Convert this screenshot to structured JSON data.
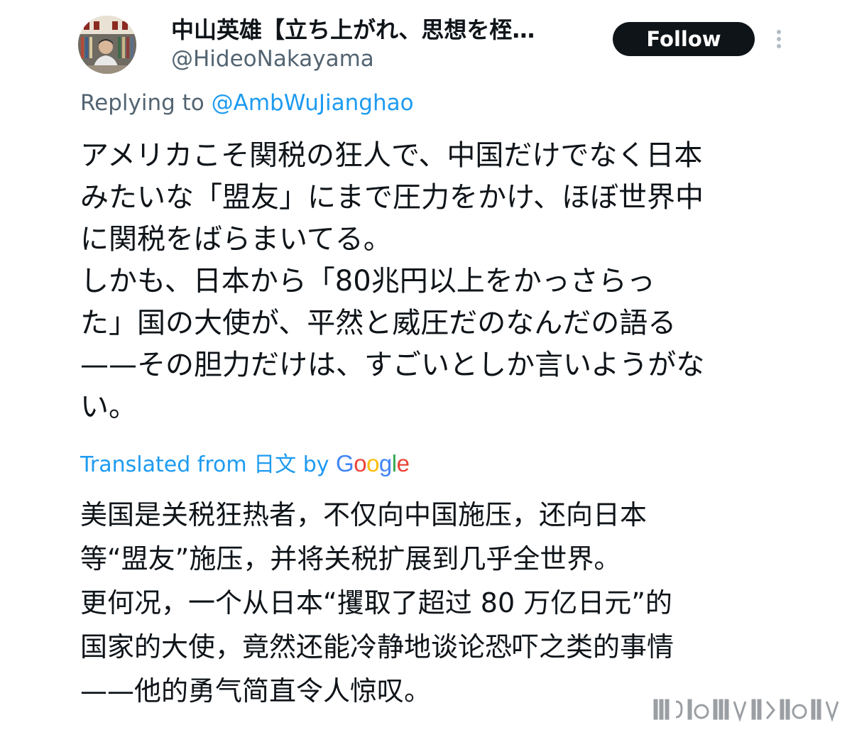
{
  "author": {
    "display_name": "中山英雄【立ち上がれ、思想を桎…",
    "handle": "@HideoNakayama"
  },
  "actions": {
    "follow_label": "Follow",
    "more_icon": "more-vertical-icon"
  },
  "reply": {
    "prefix": "Replying to ",
    "target": "@AmbWuJianghao"
  },
  "tweet": {
    "original_lines": [
      "アメリカこそ関税の狂人で、中国だけでなく日本",
      "みたいな「盟友」にまで圧力をかけ、ほぼ世界中",
      "に関税をばらまいてる。",
      "しかも、日本から「80兆円以上をかっさらっ",
      "た」国の大使が、平然と威圧だのなんだの語る",
      "——その胆力だけは、すごいとしか言いようがな",
      "い。"
    ],
    "translated_lines": [
      "美国是关税狂热者，不仅向中国施压，还向日本",
      "等“盟友”施压，并将关税扩展到几乎全世界。",
      "更何况，一个从日本“攫取了超过 80 万亿日元”的",
      "国家的大使，竟然还能冷静地谈论恐吓之类的事情",
      "——他的勇气简直令人惊叹。"
    ]
  },
  "translation": {
    "prefix": "Translated from ",
    "language": "日文",
    "by": " by ",
    "provider": "Google",
    "provider_colors": [
      "#4285f4",
      "#ea4335",
      "#fbbc05",
      "#4285f4",
      "#34a853",
      "#ea4335"
    ]
  },
  "colors": {
    "text": "#0f1419",
    "secondary": "#536471",
    "link": "#1d9bf0",
    "button_bg": "#0f1419"
  }
}
